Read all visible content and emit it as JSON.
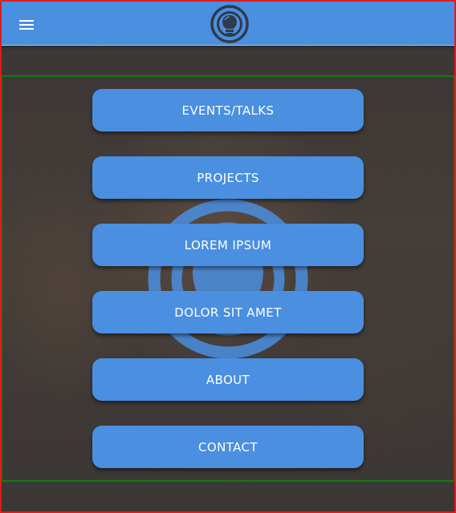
{
  "colors": {
    "appbar": "#4a8fe0",
    "button": "#4a8fe0",
    "button_text": "#ffffff",
    "background": "#3f3a37"
  },
  "appbar": {
    "menu_icon": "hamburger-menu-icon",
    "logo_icon": "circular-logo-icon"
  },
  "menu": {
    "items": [
      {
        "label": "EVENTS/TALKS"
      },
      {
        "label": "PROJECTS"
      },
      {
        "label": "LOREM IPSUM"
      },
      {
        "label": "DOLOR SIT AMET"
      },
      {
        "label": "ABOUT"
      },
      {
        "label": "CONTACT"
      }
    ]
  }
}
